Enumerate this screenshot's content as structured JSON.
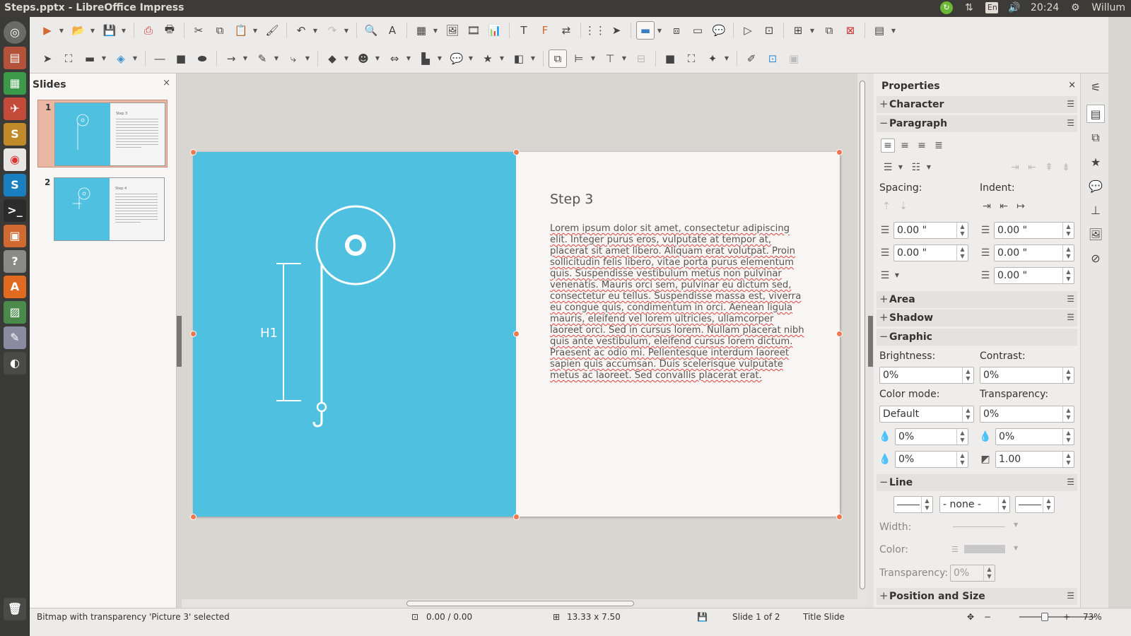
{
  "window": {
    "title": "Steps.pptx - LibreOffice Impress"
  },
  "system_tray": {
    "language": "En",
    "time": "20:24",
    "user": "Willum"
  },
  "slides_panel": {
    "title": "Slides",
    "close": "×",
    "slides": [
      {
        "number": "1",
        "heading": "Step 3"
      },
      {
        "number": "2",
        "heading": "Step 4"
      }
    ]
  },
  "slide": {
    "title": "Step 3",
    "body": "Lorem ipsum dolor sit amet, consectetur adipiscing elit. Integer purus eros, vulputate at tempor at, placerat sit amet libero. Aliquam erat volutpat. Proin sollicitudin felis libero, vitae porta purus elementum quis. Suspendisse vestibulum metus non pulvinar venenatis. Mauris orci sem, pulvinar eu dictum sed, consectetur eu tellus. Suspendisse massa est, viverra eu congue quis, condimentum in orci. Aenean ligula mauris, eleifend vel lorem ultricies, ullamcorper laoreet orci. Sed in cursus lorem. Nullam placerat nibh quis ante vestibulum, eleifend cursus lorem dictum. Praesent ac odio mi. Pellentesque interdum laoreet sapien quis accumsan. Duis scelerisque vulputate metus ac laoreet. Sed convallis placerat erat.",
    "diagram_label": "H1",
    "background_color": "#4fc0e0"
  },
  "properties": {
    "title": "Properties",
    "close": "×",
    "sections": {
      "character": "Character",
      "paragraph": "Paragraph",
      "area": "Area",
      "shadow": "Shadow",
      "graphic": "Graphic",
      "line": "Line",
      "position_size": "Position and Size"
    },
    "paragraph": {
      "spacing_label": "Spacing:",
      "indent_label": "Indent:",
      "above": "0.00 \"",
      "below": "0.00 \"",
      "before_text": "0.00 \"",
      "after_text": "0.00 \"",
      "first_line": "0.00 \""
    },
    "graphic": {
      "brightness_label": "Brightness:",
      "contrast_label": "Contrast:",
      "brightness": "0%",
      "contrast": "0%",
      "color_mode_label": "Color mode:",
      "transparency_label": "Transparency:",
      "color_mode": "Default",
      "transparency": "0%",
      "red": "0%",
      "green": "0%",
      "blue": "0%",
      "gamma": "1.00"
    },
    "line": {
      "style": "- none -",
      "width_label": "Width:",
      "color_label": "Color:",
      "transparency_label": "Transparency:",
      "transparency": "0%"
    }
  },
  "status_bar": {
    "selection": "Bitmap with transparency 'Picture 3' selected",
    "position": "0.00 / 0.00",
    "size": "13.33 x 7.50",
    "slide_info": "Slide 1 of 2",
    "layout": "Title Slide",
    "zoom_minus": "−",
    "zoom_plus": "+",
    "zoom": "73%"
  },
  "colors": {
    "accent_orange": "#f07850",
    "slide_blue": "#4fc0e0",
    "selected_thumb": "#e8b8a4"
  }
}
